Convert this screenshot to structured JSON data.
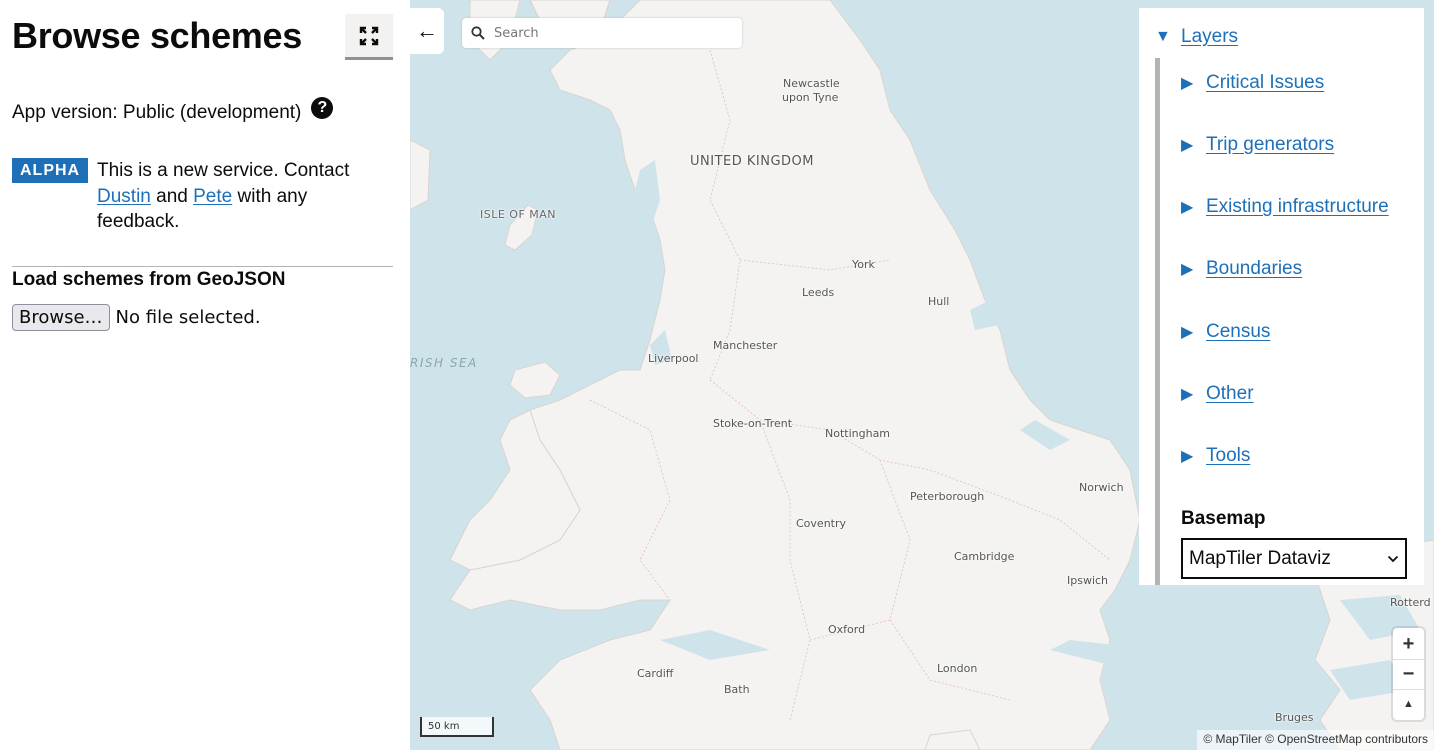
{
  "sidebar": {
    "title": "Browse schemes",
    "app_version": "App version: Public (development)",
    "phase": {
      "tag": "ALPHA",
      "text_before": "This is a new service. Contact",
      "contact_1": "Dustin",
      "text_and": "and",
      "contact_2": "Pete",
      "text_after": "with any feedback."
    },
    "load_heading": "Load schemes from GeoJSON",
    "browse_label": "Browse…",
    "file_status": "No file selected."
  },
  "map": {
    "back_icon": "←",
    "search_placeholder": "Search",
    "places": {
      "newcastle_1": "Newcastle",
      "newcastle_2": "upon Tyne",
      "uk": "UNITED KINGDOM",
      "isle_of_man": "ISLE OF MAN",
      "irish_sea": "RISH SEA",
      "york": "York",
      "leeds": "Leeds",
      "hull": "Hull",
      "manchester": "Manchester",
      "liverpool": "Liverpool",
      "stoke": "Stoke-on-Trent",
      "nottingham": "Nottingham",
      "norwich": "Norwich",
      "peterborough": "Peterborough",
      "coventry": "Coventry",
      "cambridge": "Cambridge",
      "ipswich": "Ipswich",
      "oxford": "Oxford",
      "cardiff": "Cardiff",
      "bath": "Bath",
      "london": "London",
      "bruges": "Bruges",
      "rotterdam": "Rotterd"
    },
    "scale": "50 km",
    "attribution": "© MapTiler © OpenStreetMap contributors",
    "zoom_in": "+",
    "zoom_out": "−",
    "compass": "▲"
  },
  "layers": {
    "title": "Layers",
    "items": [
      "Critical Issues",
      "Trip generators",
      "Existing infrastructure",
      "Boundaries",
      "Census",
      "Other",
      "Tools"
    ],
    "basemap_label": "Basemap",
    "basemap_value": "MapTiler Dataviz"
  },
  "colors": {
    "link": "#1d70b8",
    "sea": "#cfe4ea",
    "land": "#f4f3f1"
  }
}
